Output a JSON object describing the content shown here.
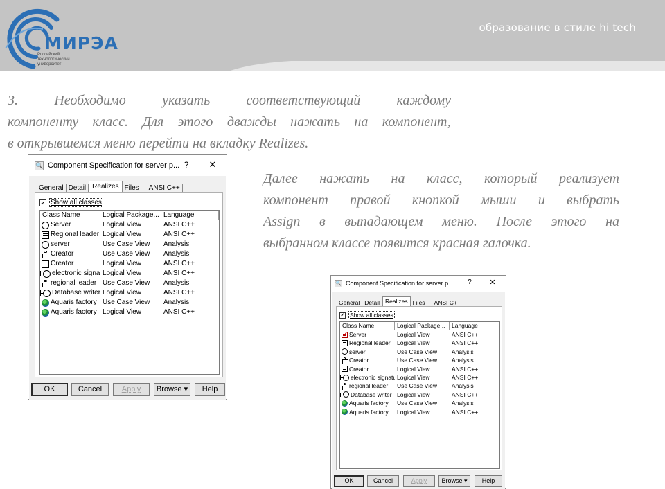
{
  "header": {
    "logo_text": "МИРЭА",
    "logo_sub": [
      "Российский",
      "технологический",
      "университет"
    ],
    "tagline": "образование в стиле hi tech"
  },
  "paragraph1": [
    "3.  Необходимо  указать  соответствующий  каждому",
    "компоненту класс. Для этого дважды нажать на компонент,",
    "в открывшемся меню перейти на вкладку Realizes."
  ],
  "paragraph2": [
    "Далее нажать на класс, который реализует",
    "компонент правой кнопкой мыши и выбрать",
    "Assign в выпадающем меню. После этого на",
    "выбранном классе появится красная галочка."
  ],
  "dialog1": {
    "title": "Component Specification for server p...",
    "help": "?",
    "close": "✕",
    "tabs": [
      "General",
      "Detail",
      "Realizes",
      "Files",
      "ANSI C++"
    ],
    "active_tab": "Realizes",
    "show_all_checked": "✓",
    "show_all_label": "Show all classes",
    "columns": [
      "Class Name",
      "Logical Package...",
      "Language"
    ],
    "rows": [
      {
        "icon": "circ",
        "name": "Server",
        "package": "Logical View",
        "language": "ANSI C++"
      },
      {
        "icon": "cls",
        "name": "Regional leader",
        "package": "Logical View",
        "language": "ANSI C++"
      },
      {
        "icon": "circ",
        "name": "server",
        "package": "Use Case View",
        "language": "Analysis"
      },
      {
        "icon": "actor",
        "name": "Creator",
        "package": "Use Case View",
        "language": "Analysis"
      },
      {
        "icon": "cls",
        "name": "Creator",
        "package": "Logical View",
        "language": "ANSI C++"
      },
      {
        "icon": "circ-line",
        "name": "electronic signatur",
        "package": "Logical View",
        "language": "ANSI C++"
      },
      {
        "icon": "actor",
        "name": "regional leader",
        "package": "Use Case View",
        "language": "Analysis"
      },
      {
        "icon": "circ-line",
        "name": "Database writer",
        "package": "Logical View",
        "language": "ANSI C++"
      },
      {
        "icon": "globe",
        "name": "Aquaris factory",
        "package": "Use Case View",
        "language": "Analysis"
      },
      {
        "icon": "globe",
        "name": "Aquaris factory",
        "package": "Logical View",
        "language": "ANSI C++"
      }
    ],
    "buttons": {
      "ok": "OK",
      "cancel": "Cancel",
      "apply": "Apply",
      "browse": "Browse ▾",
      "help": "Help"
    }
  },
  "dialog2": {
    "title": "Component Specification for server p...",
    "help": "?",
    "close": "✕",
    "tabs": [
      "General",
      "Detail",
      "Realizes",
      "Files",
      "ANSI C++"
    ],
    "active_tab": "Realizes",
    "show_all_checked": "✓",
    "show_all_label": "Show all classes",
    "columns": [
      "Class Name",
      "Logical Package...",
      "Language"
    ],
    "rows": [
      {
        "icon": "cls-red",
        "name": "Server",
        "package": "Logical View",
        "language": "ANSI C++"
      },
      {
        "icon": "cls",
        "name": "Regional leader",
        "package": "Logical View",
        "language": "ANSI C++"
      },
      {
        "icon": "circ",
        "name": "server",
        "package": "Use Case View",
        "language": "Analysis"
      },
      {
        "icon": "actor",
        "name": "Creator",
        "package": "Use Case View",
        "language": "Analysis"
      },
      {
        "icon": "cls",
        "name": "Creator",
        "package": "Logical View",
        "language": "ANSI C++"
      },
      {
        "icon": "circ-line",
        "name": "electronic signatur",
        "package": "Logical View",
        "language": "ANSI C++"
      },
      {
        "icon": "actor",
        "name": "regional leader",
        "package": "Use Case View",
        "language": "Analysis"
      },
      {
        "icon": "circ-line",
        "name": "Database writer",
        "package": "Logical View",
        "language": "ANSI C++"
      },
      {
        "icon": "globe",
        "name": "Aquaris factory",
        "package": "Use Case View",
        "language": "Analysis"
      },
      {
        "icon": "globe",
        "name": "Aquaris factory",
        "package": "Logical View",
        "language": "ANSI C++"
      }
    ],
    "buttons": {
      "ok": "OK",
      "cancel": "Cancel",
      "apply": "Apply",
      "browse": "Browse ▾",
      "help": "Help"
    }
  }
}
